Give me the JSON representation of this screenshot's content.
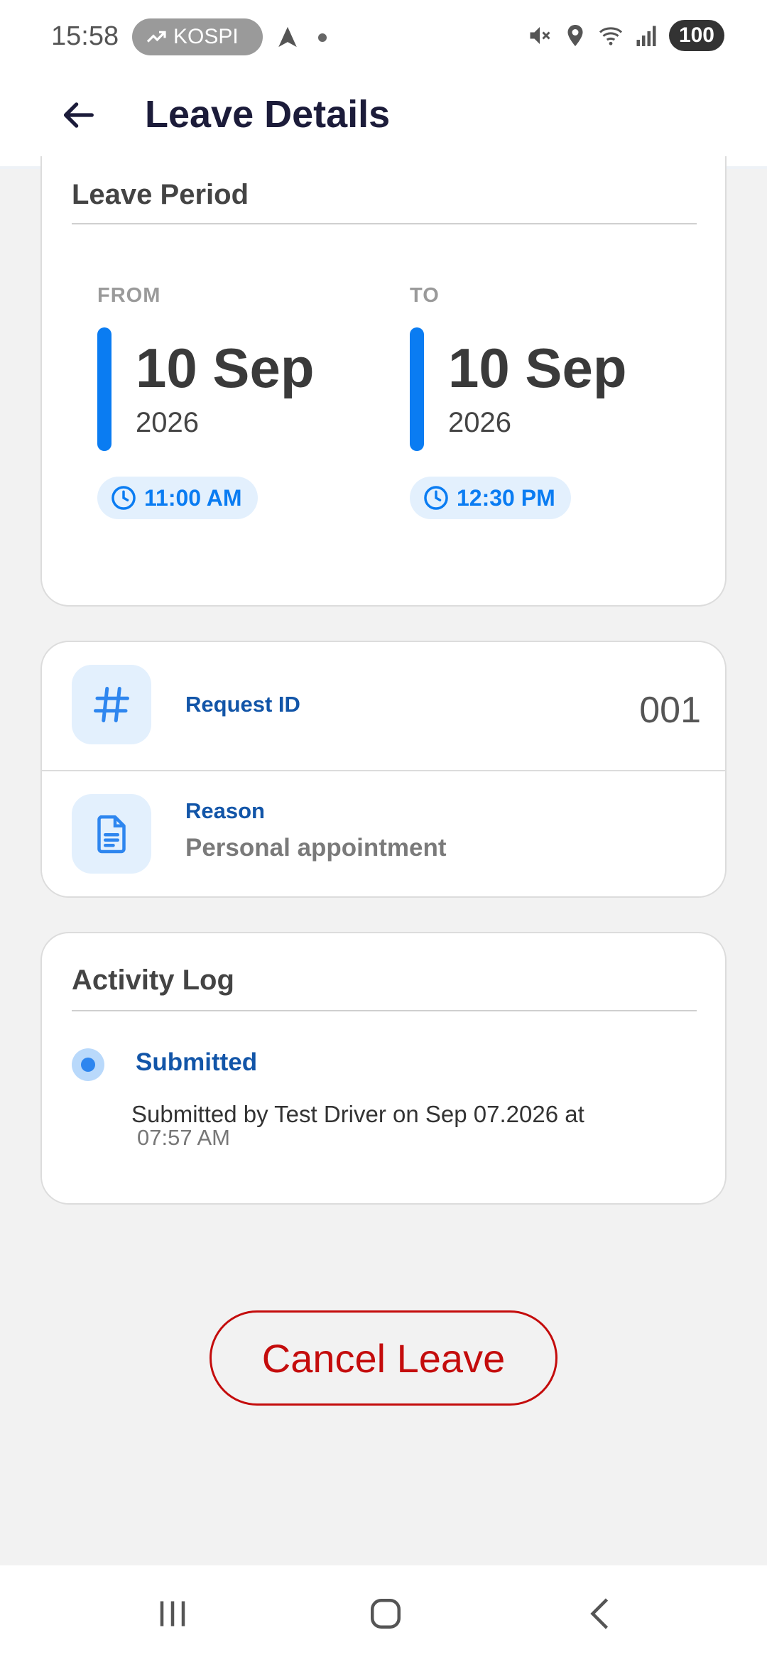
{
  "status_bar": {
    "time": "15:58",
    "ticker_label": "KOSPI",
    "battery": "100",
    "icons": [
      "trend-up-icon",
      "navigation-arrow-icon",
      "mute-icon",
      "location-icon",
      "wifi-icon",
      "signal-icon"
    ]
  },
  "header": {
    "title": "Leave Details",
    "back_icon": "arrow-left-icon"
  },
  "leave_period": {
    "heading": "Leave Period",
    "from": {
      "label": "FROM",
      "day_month": "10 Sep",
      "year": "2026",
      "time": "11:00 AM"
    },
    "to": {
      "label": "TO",
      "day_month": "10 Sep",
      "year": "2026",
      "time": "12:30 PM"
    }
  },
  "details": {
    "request_id": {
      "label": "Request ID",
      "value": "001",
      "icon": "hash-icon"
    },
    "reason": {
      "label": "Reason",
      "value": "Personal appointment",
      "icon": "document-icon"
    }
  },
  "activity_log": {
    "heading": "Activity Log",
    "entries": [
      {
        "status": "Submitted",
        "description": "Submitted by Test Driver on Sep 07.2026 at",
        "time": "07:57 AM"
      }
    ]
  },
  "actions": {
    "cancel_label": "Cancel Leave"
  },
  "colors": {
    "accent_blue": "#0a7cf2",
    "label_blue": "#1255a8",
    "danger_red": "#c40c0c",
    "chip_bg": "#e3f0fd",
    "page_bg": "#f2f2f2"
  },
  "nav_bar": {
    "icons": [
      "recent-apps-icon",
      "home-icon",
      "back-icon"
    ]
  }
}
